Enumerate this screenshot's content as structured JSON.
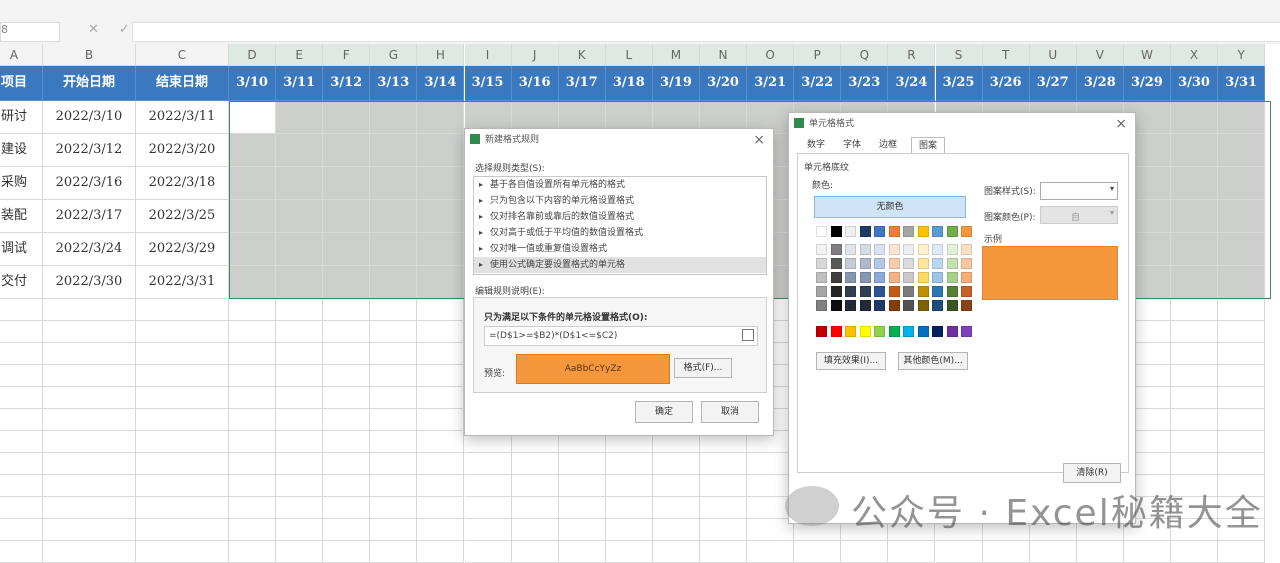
{
  "formula_bar": {
    "name_box": "8",
    "fx_label": "✕ ✓ fx",
    "value": ""
  },
  "columns": [
    "A",
    "B",
    "C",
    "D",
    "E",
    "F",
    "G",
    "H",
    "I",
    "J",
    "K",
    "L",
    "M",
    "N",
    "O",
    "P",
    "Q",
    "R",
    "S",
    "T",
    "U",
    "V",
    "W",
    "X",
    "Y"
  ],
  "header_row": [
    "项目",
    "开始日期",
    "结束日期",
    "3/10",
    "3/11",
    "3/12",
    "3/13",
    "3/14",
    "3/15",
    "3/16",
    "3/17",
    "3/18",
    "3/19",
    "3/20",
    "3/21",
    "3/22",
    "3/23",
    "3/24",
    "3/25",
    "3/26",
    "3/27",
    "3/28",
    "3/29",
    "3/30",
    "3/31"
  ],
  "rows": [
    {
      "a": "研讨",
      "b": "2022/3/10",
      "c": "2022/3/11"
    },
    {
      "a": "建设",
      "b": "2022/3/12",
      "c": "2022/3/20"
    },
    {
      "a": "采购",
      "b": "2022/3/16",
      "c": "2022/3/18"
    },
    {
      "a": "装配",
      "b": "2022/3/17",
      "c": "2022/3/25"
    },
    {
      "a": "调试",
      "b": "2022/3/24",
      "c": "2022/3/29"
    },
    {
      "a": "交付",
      "b": "2022/3/30",
      "c": "2022/3/31"
    }
  ],
  "colors": {
    "header_blue": "#3a78c0",
    "selection_gray": "#cdcfcc",
    "orange": "#f4973d",
    "accent_green": "#2e8a4e"
  },
  "new_rule_dialog": {
    "title": "新建格式规则",
    "select_type_label": "选择规则类型(S):",
    "rule_types": [
      "基于各自值设置所有单元格的格式",
      "只为包含以下内容的单元格设置格式",
      "仅对排名靠前或靠后的数值设置格式",
      "仅对高于或低于平均值的数值设置格式",
      "仅对唯一值或重复值设置格式",
      "使用公式确定要设置格式的单元格"
    ],
    "edit_label": "编辑规则说明(E):",
    "formula_label": "只为满足以下条件的单元格设置格式(O):",
    "formula": "=(D$1>=$B2)*(D$1<=$C2)",
    "preview_label": "预览:",
    "preview_text": "AaBbCcYyZz",
    "format_button": "格式(F)...",
    "ok_button": "确定",
    "cancel_button": "取消"
  },
  "format_cells_dialog": {
    "title": "单元格格式",
    "tabs": [
      "数字",
      "字体",
      "边框",
      "图案"
    ],
    "active_tab": "图案",
    "shading_label": "单元格底纹",
    "color_label": "颜色:",
    "no_color_button": "无颜色",
    "pattern_style_label": "图案样式(S):",
    "pattern_color_label": "图案颜色(P):",
    "pattern_color_value": "自",
    "sample_label": "示例",
    "fill_effects_button": "填充效果(I)...",
    "more_colors_button": "其他颜色(M)...",
    "clear_button": "清除(R)",
    "sample_color": "#f4973d",
    "palette_rows": [
      [
        "#ffffff",
        "#000000",
        "#eeeeee",
        "#1f3864",
        "#4472c4",
        "#ed7d31",
        "#a5a5a5",
        "#ffc000",
        "#5b9bd5",
        "#70ad47",
        "#f4973d"
      ],
      [
        "#f2f2f2",
        "#7f7f7f",
        "#dfe3ea",
        "#d6dce4",
        "#d9e2f3",
        "#fbe5d5",
        "#ededed",
        "#fff2cc",
        "#deebf6",
        "#e2efd9",
        "#fbe0c7"
      ],
      [
        "#d8d8d8",
        "#595959",
        "#c4cbd6",
        "#adb9ca",
        "#b4c6e7",
        "#f7cbac",
        "#dbdbdb",
        "#ffe598",
        "#bdd7ee",
        "#c5e0b3",
        "#f8c7a0"
      ],
      [
        "#bfbfbf",
        "#3f3f3f",
        "#8496b0",
        "#8496b0",
        "#8eaadb",
        "#f4b183",
        "#c9c9c9",
        "#ffd965",
        "#9dc3e6",
        "#a8d08d",
        "#f5ad77"
      ],
      [
        "#a5a5a5",
        "#262626",
        "#323f4f",
        "#323f4f",
        "#2f5496",
        "#c55a11",
        "#7b7b7b",
        "#bf9000",
        "#2e75b5",
        "#538135",
        "#c4622a"
      ],
      [
        "#7f7f7f",
        "#0c0c0c",
        "#222a35",
        "#222a35",
        "#1f3864",
        "#833c0b",
        "#525252",
        "#7f6000",
        "#1e4e79",
        "#375623",
        "#8a4218"
      ],
      [
        "#c00000",
        "#ff0000",
        "#ffc000",
        "#ffff00",
        "#92d050",
        "#00b050",
        "#00b0f0",
        "#0070c0",
        "#002060",
        "#7030a0",
        "#7f3fbf"
      ]
    ]
  },
  "watermark": {
    "text": "公众号 · Excel秘籍大全"
  }
}
